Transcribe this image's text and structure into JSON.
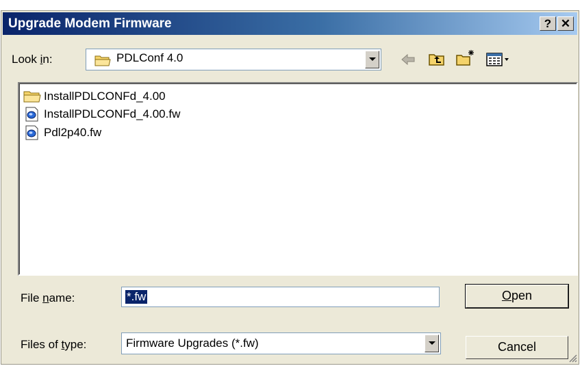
{
  "window": {
    "title": "Upgrade Modem Firmware"
  },
  "title_buttons": {
    "help": "?",
    "close": "✕"
  },
  "look_in": {
    "label_pre": "Look ",
    "label_key": "i",
    "label_post": "n:",
    "value": "PDLConf 4.0"
  },
  "toolbar": {
    "icons": [
      "back-arrow-icon",
      "up-one-level-icon",
      "new-folder-icon",
      "view-menu-icon"
    ]
  },
  "files": [
    {
      "name": "InstallPDLCONFd_4.00",
      "icon": "folder-icon"
    },
    {
      "name": "InstallPDLCONFd_4.00.fw",
      "icon": "fw-file-icon"
    },
    {
      "name": "Pdl2p40.fw",
      "icon": "fw-file-icon"
    }
  ],
  "file_name": {
    "label_pre": "File ",
    "label_key": "n",
    "label_post": "ame:",
    "value": "*.fw"
  },
  "file_type": {
    "label_pre": "Files of ",
    "label_key": "t",
    "label_post": "ype:",
    "value": "Firmware Upgrades (*.fw)"
  },
  "buttons": {
    "open_key": "O",
    "open_rest": "pen",
    "cancel": "Cancel"
  },
  "colors": {
    "title_start": "#0a246a",
    "title_end": "#a6caf0",
    "face": "#ece9d8",
    "selection": "#0a246a"
  }
}
